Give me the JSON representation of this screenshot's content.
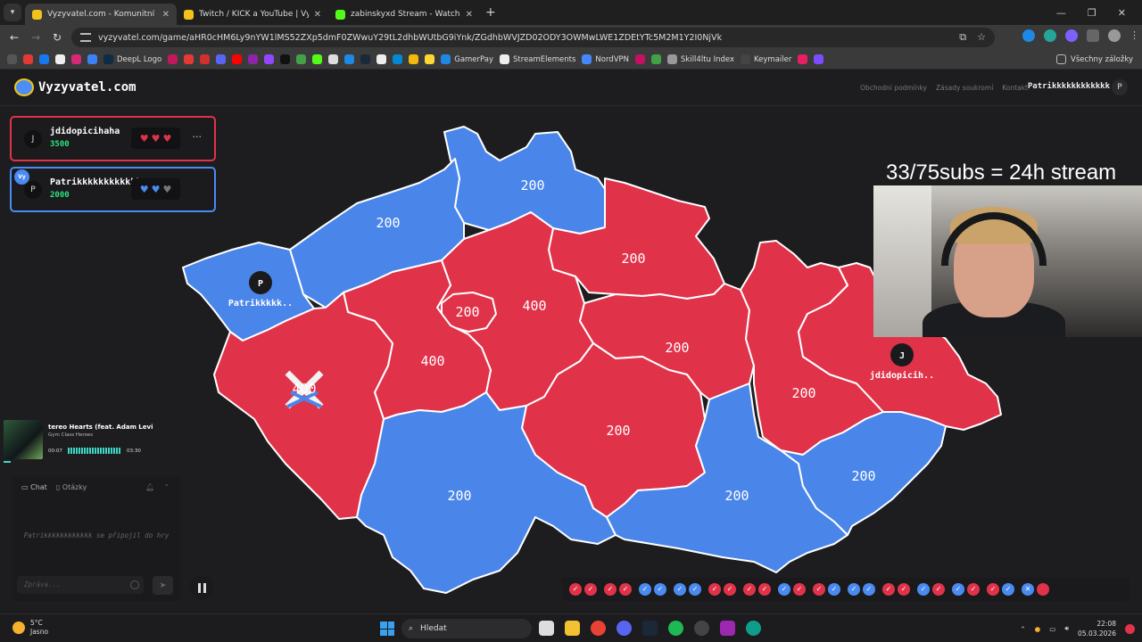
{
  "browser": {
    "tabs": [
      {
        "title": "Vyzyvatel.com - Komunitní vědo",
        "active": true,
        "color": "#f3c31b"
      },
      {
        "title": "Twitch / KICK a YouTube | Vyzyv",
        "active": false,
        "color": "#f3c31b"
      },
      {
        "title": "zabinskyxd Stream - Watch Live",
        "active": false,
        "color": "#53fc18"
      }
    ],
    "new_tab": "+",
    "url": "vyzyvatel.com/game/aHR0cHM6Ly9nYW1lMS52ZXp5dmF0ZWwuY29tL2dhbWUtbG9iYnk/ZGdhbWVJZD02ODY3OWMwLWE1ZDEtYTc5M2M1Y2I0NjVk",
    "bookmarks": [
      "DeepL Logo",
      "GamerPay",
      "StreamElements",
      "NordVPN",
      "Skill4ltu Index",
      "Keymailer"
    ],
    "all_bookmarks": "Všechny záložky"
  },
  "site": {
    "logo": "Vyzyvatel.com",
    "links": [
      "Obchodní podmínky",
      "Zásady soukromí",
      "Kontakt"
    ],
    "user": "Patrikkkkkkkkkkkk",
    "user_initial": "P"
  },
  "players": [
    {
      "initial": "J",
      "name": "jdidopicihaha",
      "score": "3500",
      "team": "red",
      "hearts": [
        "full",
        "full",
        "full"
      ]
    },
    {
      "initial": "P",
      "name": "Patrikkkkkkkkkkkk",
      "score": "2000",
      "team": "blue",
      "badge": "Vy",
      "hearts": [
        "full",
        "full",
        "empty"
      ]
    }
  ],
  "music": {
    "title": "tereo Hearts (feat. Adam Levi",
    "artist": "Gym Class Heroes",
    "elapsed": "00:07",
    "duration": "03:30",
    "progress": 0.03
  },
  "chat": {
    "tab_chat": "Chat",
    "tab_questions": "Otázky",
    "message": "Patrikkkkkkkkkkkk se připojil do hry",
    "placeholder": "Zpráva..."
  },
  "overlay": {
    "subs_text": "33/75subs = 24h stream"
  },
  "map": {
    "colors": {
      "red": "#e0334a",
      "blue": "#4a86ea",
      "border": "#ffffff"
    },
    "regions": [
      {
        "id": "liberec",
        "owner": "blue",
        "value": "200"
      },
      {
        "id": "usti",
        "owner": "blue",
        "value": "200"
      },
      {
        "id": "karlovy-vary",
        "owner": "blue",
        "value": ""
      },
      {
        "id": "hradec",
        "owner": "red",
        "value": "200"
      },
      {
        "id": "stredocesky",
        "owner": "red",
        "value": "400"
      },
      {
        "id": "praha",
        "owner": "red",
        "value": "200"
      },
      {
        "id": "plzen",
        "owner": "red",
        "value": "400"
      },
      {
        "id": "pardubice",
        "owner": "red",
        "value": "200"
      },
      {
        "id": "vysocina",
        "owner": "red",
        "value": "200"
      },
      {
        "id": "olomouc",
        "owner": "red",
        "value": "200"
      },
      {
        "id": "moravskoslezsky",
        "owner": "red",
        "value": ""
      },
      {
        "id": "jihocesky",
        "owner": "blue",
        "value": "200"
      },
      {
        "id": "jihomoravsky",
        "owner": "blue",
        "value": "200"
      },
      {
        "id": "zlin",
        "owner": "blue",
        "value": "200"
      },
      {
        "id": "battle",
        "owner": "contested",
        "value": "400"
      }
    ],
    "markers": [
      {
        "initial": "P",
        "label": "Patrikkkkk.."
      },
      {
        "initial": "J",
        "label": "jdidopicih.."
      }
    ]
  },
  "rounds": [
    [
      "red",
      "red"
    ],
    [
      "red",
      "red"
    ],
    [
      "blue",
      "blue"
    ],
    [
      "blue",
      "blue"
    ],
    [
      "red",
      "red"
    ],
    [
      "red",
      "red"
    ],
    [
      "blue",
      "red"
    ],
    [
      "red",
      "blue"
    ],
    [
      "blue",
      "blue"
    ],
    [
      "red",
      "red"
    ],
    [
      "blue",
      "red"
    ],
    [
      "blue",
      "red"
    ],
    [
      "red",
      "blue"
    ],
    [
      "x-blue",
      "dot-red"
    ]
  ],
  "taskbar": {
    "temp": "5°C",
    "weather": "Jasno",
    "search": "Hledat",
    "time": "22:08",
    "date": "05.03.2026"
  }
}
